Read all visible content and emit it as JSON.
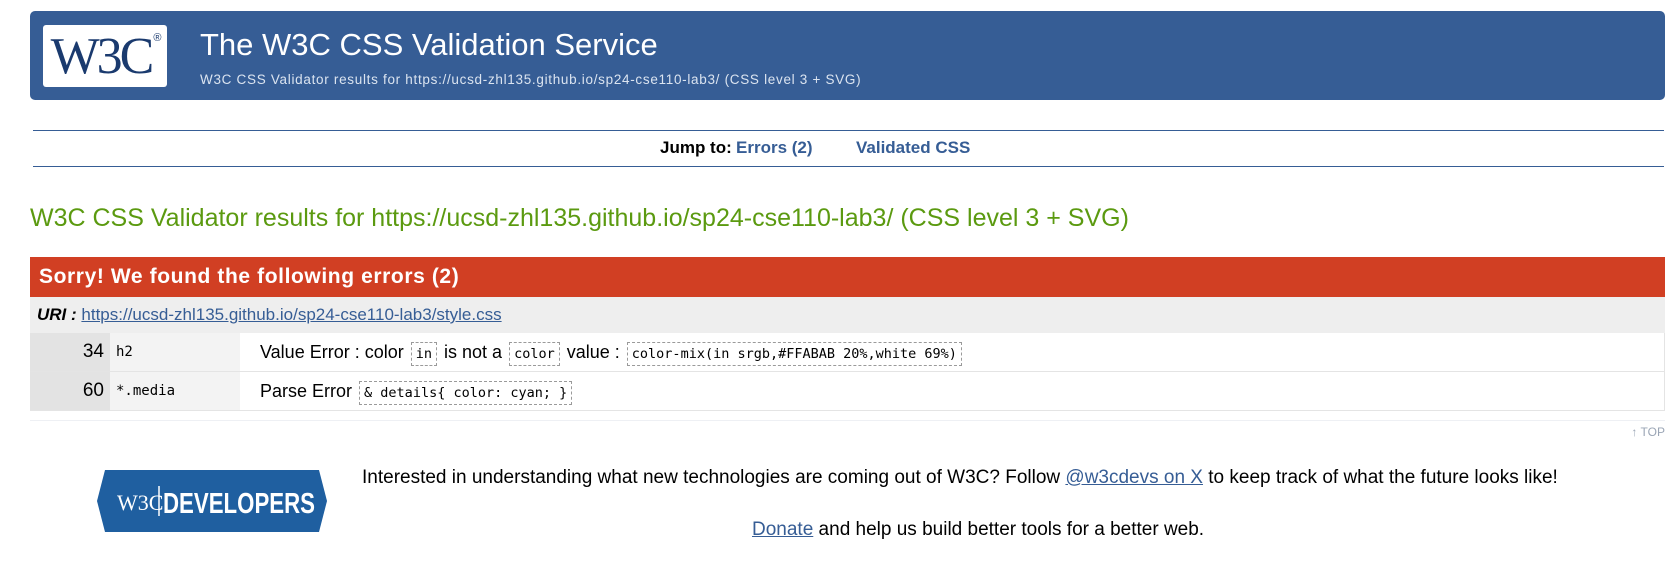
{
  "banner": {
    "logo_text": "W3C",
    "logo_mark": "®",
    "title": "The W3C CSS Validation Service",
    "subtitle": "W3C CSS Validator results for https://ucsd-zhl135.github.io/sp24-cse110-lab3/ (CSS level 3 + SVG)"
  },
  "jump": {
    "label": "Jump to:",
    "errors_link": "Errors (2)",
    "validated_link": "Validated CSS"
  },
  "results_heading": "W3C CSS Validator results for https://ucsd-zhl135.github.io/sp24-cse110-lab3/ (CSS level 3 + SVG)",
  "errors": {
    "header": "Sorry! We found the following errors (2)",
    "uri_label": "URI :",
    "uri": "https://ucsd-zhl135.github.io/sp24-cse110-lab3/style.css",
    "rows": [
      {
        "line": "34",
        "context": "h2",
        "msg_a": "Value Error : color",
        "tok_a": "in",
        "msg_b": "is not a",
        "tok_b": "color",
        "msg_c": "value :",
        "tok_c": "color-mix(in srgb,#FFABAB 20%,white 69%)"
      },
      {
        "line": "60",
        "context": "*.media",
        "msg_a": "Parse Error",
        "tok_a": "& details{ color: cyan; }"
      }
    ]
  },
  "top_link": "↑ TOP",
  "footer": {
    "badge_w3c": "W3C",
    "badge_text": "DEVELOPERS",
    "promo_before": "Interested in understanding what new technologies are coming out of W3C? Follow ",
    "promo_link": "@w3cdevs on X",
    "promo_after": " to keep track of what the future looks like!",
    "donate_link": "Donate",
    "donate_after": " and help us build better tools for a better web."
  },
  "colors": {
    "banner": "#365d95",
    "error_header": "#d13f23",
    "results_heading": "#5b9a10",
    "link": "#365d95"
  }
}
